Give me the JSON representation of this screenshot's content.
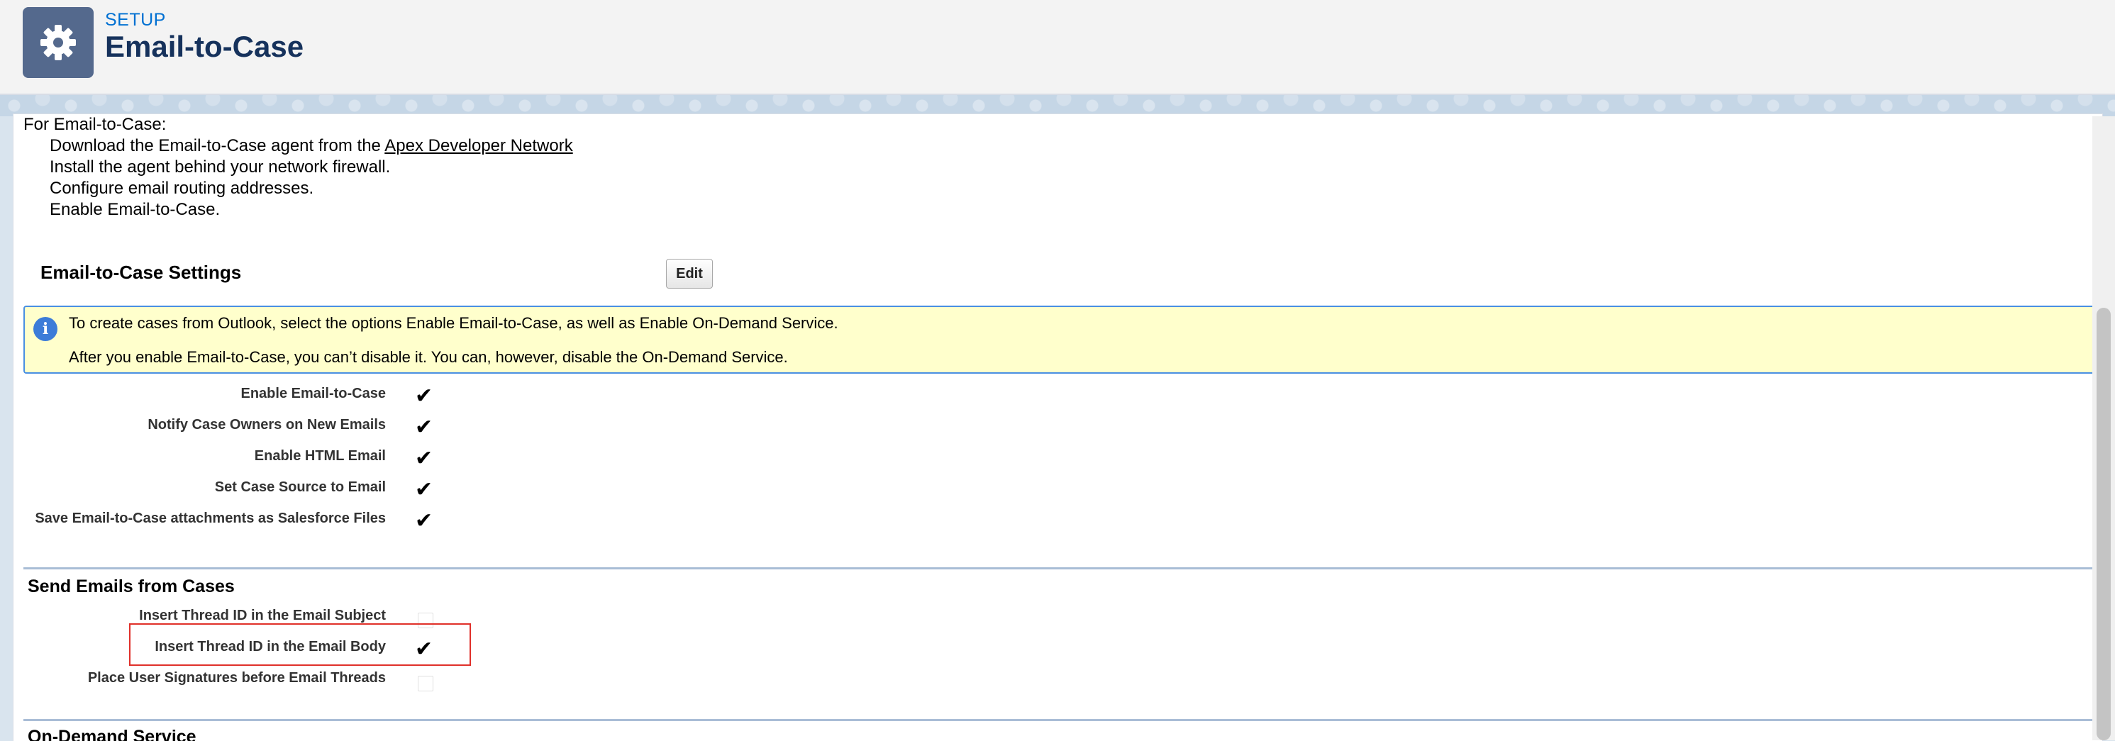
{
  "header": {
    "kicker": "SETUP",
    "title": "Email-to-Case",
    "icon": "gear-icon"
  },
  "intro": {
    "heading": "For Email-to-Case:",
    "step1_prefix": "Download the Email-to-Case agent from the ",
    "step1_link": "Apex Developer Network",
    "step2": "Install the agent behind your network firewall.",
    "step3": "Configure email routing addresses.",
    "step4": "Enable Email-to-Case."
  },
  "settings": {
    "title": "Email-to-Case Settings",
    "edit_label": "Edit",
    "info_line1": "To create cases from Outlook, select the options Enable Email-to-Case, as well as Enable On-Demand Service.",
    "info_line2": "After you enable Email-to-Case, you can’t disable it. You can, however, disable the On-Demand Service.",
    "rows": [
      {
        "label": "Enable Email-to-Case",
        "checked": true
      },
      {
        "label": "Notify Case Owners on New Emails",
        "checked": true
      },
      {
        "label": "Enable HTML Email",
        "checked": true
      },
      {
        "label": "Set Case Source to Email",
        "checked": true
      },
      {
        "label": "Save Email-to-Case attachments as Salesforce Files",
        "checked": true
      }
    ]
  },
  "send_emails": {
    "title": "Send Emails from Cases",
    "rows": [
      {
        "label": "Insert Thread ID in the Email Subject",
        "checked": false
      },
      {
        "label": "Insert Thread ID in the Email Body",
        "checked": true
      },
      {
        "label": "Place User Signatures before Email Threads",
        "checked": false
      }
    ]
  },
  "on_demand": {
    "title": "On-Demand Service"
  },
  "colors": {
    "highlight": "#e0302a",
    "link": "#0070d2",
    "info_bg": "#ffffcc"
  }
}
